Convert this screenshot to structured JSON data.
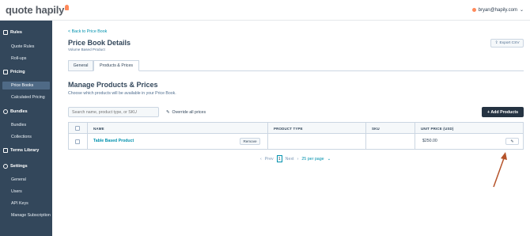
{
  "brand": {
    "logo_text": "quote hapily"
  },
  "user": {
    "email": "bryan@hapily.com",
    "caret": "⌄"
  },
  "sidebar": {
    "sections": [
      {
        "label": "Rules",
        "items": [
          "Quote Rules",
          "Roll-ups"
        ]
      },
      {
        "label": "Pricing",
        "items": [
          "Price Books",
          "Calculated Pricing"
        ],
        "active": "Price Books"
      },
      {
        "label": "Bundles",
        "items": [
          "Bundles",
          "Collections"
        ]
      },
      {
        "label": "Terms Library",
        "items": []
      },
      {
        "label": "Settings",
        "items": [
          "General",
          "Users",
          "API Keys",
          "Manage Subscription"
        ]
      }
    ]
  },
  "page": {
    "back_link": "< Back to Price Book",
    "title": "Price Book Details",
    "subtitle": "Volume Based Product",
    "export_label": "Export CSV",
    "tabs": [
      "General",
      "Products & Prices"
    ],
    "active_tab": "Products & Prices"
  },
  "manage": {
    "title": "Manage Products & Prices",
    "description": "Choose which products will be available in your Price Book.",
    "search_placeholder": "Search name, product type, or SKU",
    "override_label": "Override all prices",
    "add_label": "+ Add Products"
  },
  "table": {
    "columns": [
      "NAME",
      "PRODUCT TYPE",
      "SKU",
      "UNIT PRICE (USD)"
    ],
    "rows": [
      {
        "name": "Table Based Product",
        "product_type": "",
        "sku": "",
        "unit_price": "$250.00",
        "remove_label": "Remove"
      }
    ]
  },
  "pagination": {
    "prev_label": "Prev",
    "current_page": "1",
    "next_label": "Next",
    "per_page_label": "25 per page"
  },
  "colors": {
    "sidebar_bg": "#33475b",
    "accent_link": "#0091ae",
    "primary_button": "#253342",
    "annotation_arrow": "#b5532a"
  }
}
